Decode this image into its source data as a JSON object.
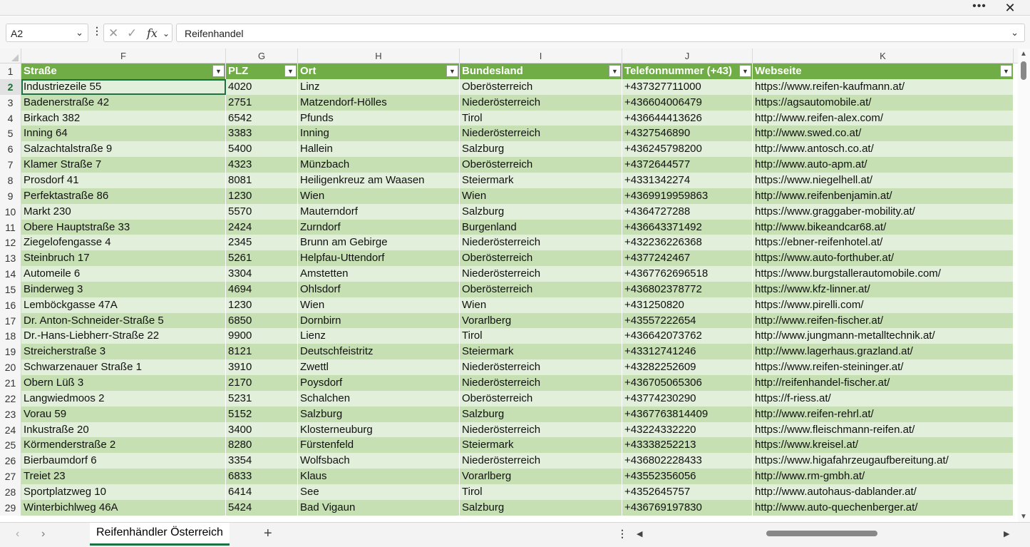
{
  "titlebar": {
    "more_icon": "•••",
    "close_icon": "✕"
  },
  "formula_bar": {
    "name_box": "A2",
    "formula": "Reifenhandel",
    "fx_label": "fx"
  },
  "columns": [
    {
      "letter": "F",
      "header": "Straße"
    },
    {
      "letter": "G",
      "header": "PLZ"
    },
    {
      "letter": "H",
      "header": "Ort"
    },
    {
      "letter": "I",
      "header": "Bundesland"
    },
    {
      "letter": "J",
      "header": "Telefonnummer (+43)"
    },
    {
      "letter": "K",
      "header": "Webseite"
    }
  ],
  "rows": [
    {
      "num": "2",
      "cells": [
        "Industriezeile 55",
        "4020",
        "Linz",
        "Oberösterreich",
        "+437327711000",
        "https://www.reifen-kaufmann.at/"
      ]
    },
    {
      "num": "3",
      "cells": [
        "Badenerstraße 42",
        "2751",
        "Matzendorf-Hölles",
        "Niederösterreich",
        "+436604006479",
        "https://agsautomobile.at/"
      ]
    },
    {
      "num": "4",
      "cells": [
        "Birkach 382",
        "6542",
        "Pfunds",
        "Tirol",
        "+436644413626",
        "http://www.reifen-alex.com/"
      ]
    },
    {
      "num": "5",
      "cells": [
        "Inning 64",
        "3383",
        "Inning",
        "Niederösterreich",
        "+4327546890",
        "http://www.swed.co.at/"
      ]
    },
    {
      "num": "6",
      "cells": [
        "Salzachtalstraße 9",
        "5400",
        "Hallein",
        "Salzburg",
        "+436245798200",
        "http://www.antosch.co.at/"
      ]
    },
    {
      "num": "7",
      "cells": [
        "Klamer Straße 7",
        "4323",
        "Münzbach",
        "Oberösterreich",
        "+4372644577",
        "http://www.auto-apm.at/"
      ]
    },
    {
      "num": "8",
      "cells": [
        "Prosdorf 41",
        "8081",
        "Heiligenkreuz am Waasen",
        "Steiermark",
        "+4331342274",
        "https://www.niegelhell.at/"
      ]
    },
    {
      "num": "9",
      "cells": [
        "Perfektastraße 86",
        "1230",
        "Wien",
        "Wien",
        "+4369919959863",
        "http://www.reifenbenjamin.at/"
      ]
    },
    {
      "num": "10",
      "cells": [
        "Markt 230",
        "5570",
        "Mauterndorf",
        "Salzburg",
        "+4364727288",
        "https://www.graggaber-mobility.at/"
      ]
    },
    {
      "num": "11",
      "cells": [
        "Obere Hauptstraße 33",
        "2424",
        "Zurndorf",
        "Burgenland",
        "+436643371492",
        "http://www.bikeandcar68.at/"
      ]
    },
    {
      "num": "12",
      "cells": [
        "Ziegelofengasse 4",
        "2345",
        "Brunn am Gebirge",
        "Niederösterreich",
        "+432236226368",
        "https://ebner-reifenhotel.at/"
      ]
    },
    {
      "num": "13",
      "cells": [
        "Steinbruch 17",
        "5261",
        "Helpfau-Uttendorf",
        "Oberösterreich",
        "+4377242467",
        "https://www.auto-forthuber.at/"
      ]
    },
    {
      "num": "14",
      "cells": [
        "Automeile 6",
        "3304",
        "Amstetten",
        "Niederösterreich",
        "+4367762696518",
        "https://www.burgstallerautomobile.com/"
      ]
    },
    {
      "num": "15",
      "cells": [
        "Binderweg 3",
        "4694",
        "Ohlsdorf",
        "Oberösterreich",
        "+436802378772",
        "https://www.kfz-linner.at/"
      ]
    },
    {
      "num": "16",
      "cells": [
        "Lemböckgasse 47A",
        "1230",
        "Wien",
        "Wien",
        "+431250820",
        "https://www.pirelli.com/"
      ]
    },
    {
      "num": "17",
      "cells": [
        "Dr. Anton-Schneider-Straße 5",
        "6850",
        "Dornbirn",
        "Vorarlberg",
        "+43557222654",
        "http://www.reifen-fischer.at/"
      ]
    },
    {
      "num": "18",
      "cells": [
        "Dr.-Hans-Liebherr-Straße 22",
        "9900",
        "Lienz",
        "Tirol",
        "+436642073762",
        "http://www.jungmann-metalltechnik.at/"
      ]
    },
    {
      "num": "19",
      "cells": [
        "Streicherstraße 3",
        "8121",
        "Deutschfeistritz",
        "Steiermark",
        "+43312741246",
        "http://www.lagerhaus.grazland.at/"
      ]
    },
    {
      "num": "20",
      "cells": [
        "Schwarzenauer Straße 1",
        "3910",
        "Zwettl",
        "Niederösterreich",
        "+43282252609",
        "https://www.reifen-steininger.at/"
      ]
    },
    {
      "num": "21",
      "cells": [
        "Obern Lüß 3",
        "2170",
        "Poysdorf",
        "Niederösterreich",
        "+436705065306",
        "http://reifenhandel-fischer.at/"
      ]
    },
    {
      "num": "22",
      "cells": [
        "Langwiedmoos 2",
        "5231",
        "Schalchen",
        "Oberösterreich",
        "+43774230290",
        "https://f-riess.at/"
      ]
    },
    {
      "num": "23",
      "cells": [
        "Vorau 59",
        "5152",
        "Salzburg",
        "Salzburg",
        "+4367763814409",
        "http://www.reifen-rehrl.at/"
      ]
    },
    {
      "num": "24",
      "cells": [
        "Inkustraße 20",
        "3400",
        "Klosterneuburg",
        "Niederösterreich",
        "+43224332220",
        "https://www.fleischmann-reifen.at/"
      ]
    },
    {
      "num": "25",
      "cells": [
        "Körmenderstraße 2",
        "8280",
        "Fürstenfeld",
        "Steiermark",
        "+43338252213",
        "https://www.kreisel.at/"
      ]
    },
    {
      "num": "26",
      "cells": [
        "Bierbaumdorf 6",
        "3354",
        "Wolfsbach",
        "Niederösterreich",
        "+436802228433",
        "https://www.higafahrzeugaufbereitung.at/"
      ]
    },
    {
      "num": "27",
      "cells": [
        "Treiet 23",
        "6833",
        "Klaus",
        "Vorarlberg",
        "+43552356056",
        "http://www.rm-gmbh.at/"
      ]
    },
    {
      "num": "28",
      "cells": [
        "Sportplatzweg 10",
        "6414",
        "See",
        "Tirol",
        "+4352645757",
        "http://www.autohaus-dablander.at/"
      ]
    },
    {
      "num": "29",
      "cells": [
        "Winterbichlweg 46A",
        "5424",
        "Bad Vigaun",
        "Salzburg",
        "+436769197830",
        "http://www.auto-quechenberger.at/"
      ]
    }
  ],
  "sheet": {
    "tab_name": "Reifenhändler Österreich",
    "add_icon": "+"
  },
  "colors": {
    "header_green": "#70ad47",
    "band_dark": "#c6e0b4",
    "band_light": "#e2efda",
    "accent": "#1e7145"
  }
}
